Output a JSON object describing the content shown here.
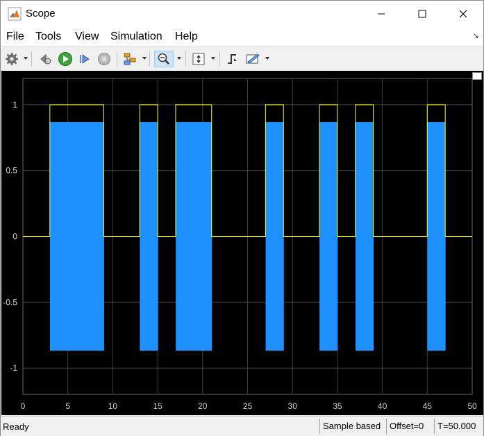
{
  "window": {
    "title": "Scope"
  },
  "menu": {
    "file": "File",
    "tools": "Tools",
    "view": "View",
    "simulation": "Simulation",
    "help": "Help"
  },
  "toolbar": {
    "icons": [
      "gear-icon",
      "rewind-icon",
      "run-icon",
      "step-forward-icon",
      "stop-icon",
      "signal-select-icon",
      "zoom-icon",
      "autoscale-icon",
      "trigger-icon",
      "measure-icon"
    ],
    "zoom_active": true
  },
  "status": {
    "ready": "Ready",
    "sample_mode": "Sample based",
    "offset": "Offset=0",
    "time": "T=50.000"
  },
  "colors": {
    "plot_bg": "#000000",
    "axes_bg": "#000000",
    "grid": "#404040",
    "series_pulse": "#ffff00",
    "series_modulated": "#1e90ff"
  },
  "chart_data": {
    "type": "line",
    "xlim": [
      0,
      50
    ],
    "ylim": [
      -1.2,
      1.2
    ],
    "x_ticks": [
      0,
      5,
      10,
      15,
      20,
      25,
      30,
      35,
      40,
      45,
      50
    ],
    "y_ticks": [
      1,
      0.5,
      0,
      -0.5,
      -1
    ],
    "grid": true,
    "series": [
      {
        "color": "#ffff00",
        "type": "pulse",
        "high": 1,
        "low": 0,
        "intervals": [
          [
            3,
            9
          ],
          [
            13,
            15
          ],
          [
            17,
            21
          ],
          [
            27,
            29
          ],
          [
            33,
            35
          ],
          [
            37,
            39
          ],
          [
            45,
            47
          ]
        ]
      },
      {
        "color": "#1e90ff",
        "type": "modulated",
        "amplitude": 0.866,
        "zero_level": 0,
        "intervals": [
          [
            3,
            9
          ],
          [
            13,
            15
          ],
          [
            17,
            21
          ],
          [
            27,
            29
          ],
          [
            33,
            35
          ],
          [
            37,
            39
          ],
          [
            45,
            47
          ]
        ]
      }
    ]
  }
}
